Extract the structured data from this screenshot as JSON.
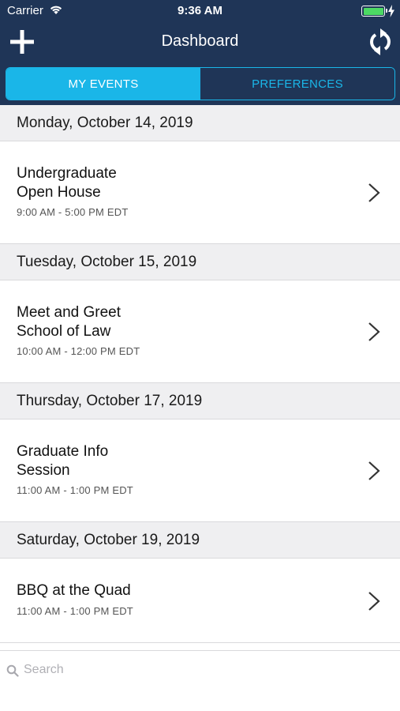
{
  "status_bar": {
    "carrier": "Carrier",
    "time": "9:36 AM",
    "battery_level": 1.0,
    "battery_color": "#4cd964"
  },
  "nav": {
    "title": "Dashboard",
    "add_icon": "plus-icon",
    "refresh_icon": "refresh-icon"
  },
  "tabs": [
    {
      "label": "MY EVENTS",
      "active": true
    },
    {
      "label": "PREFERENCES",
      "active": false
    }
  ],
  "sections": [
    {
      "date": "Monday, October 14, 2019",
      "events": [
        {
          "title_line1": "Undergraduate",
          "title_line2": "Open House",
          "time": "9:00 AM - 5:00 PM EDT"
        }
      ]
    },
    {
      "date": "Tuesday, October 15, 2019",
      "events": [
        {
          "title_line1": "Meet and Greet",
          "title_line2": "School of Law",
          "time": "10:00 AM - 12:00 PM EDT"
        }
      ]
    },
    {
      "date": "Thursday, October 17, 2019",
      "events": [
        {
          "title_line1": "Graduate Info",
          "title_line2": "Session",
          "time": "11:00 AM - 1:00 PM EDT"
        }
      ]
    },
    {
      "date": "Saturday, October 19, 2019",
      "events": [
        {
          "title_line1": "BBQ at the Quad",
          "title_line2": "",
          "time": "11:00 AM - 1:00 PM EDT"
        }
      ]
    }
  ],
  "search": {
    "placeholder": "Search",
    "value": ""
  },
  "colors": {
    "header_bg": "#1f3557",
    "accent": "#1ab6e8",
    "section_bg": "#efeff1"
  }
}
